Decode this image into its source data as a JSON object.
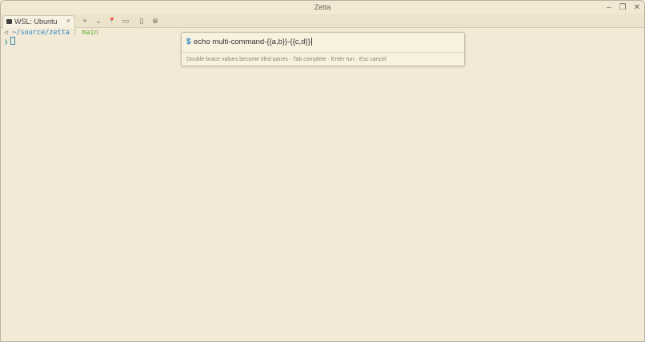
{
  "window": {
    "title": "Zetta",
    "controls": {
      "minimize": "–",
      "maximize": "❐",
      "close": "✕"
    }
  },
  "tabs": [
    {
      "label": "WSL: Ubuntu",
      "icon": "terminal-icon",
      "close": "×",
      "active": true
    }
  ],
  "toolbar": {
    "new_tab": "+",
    "dropdown": "⌄",
    "pin": "📍",
    "archive": "▭",
    "split": "▯",
    "globe": "⊕"
  },
  "terminal": {
    "path_prefix": "◁ ",
    "path": "~/source/zetta",
    "branch_icon": "ᚴ",
    "branch": "main",
    "prompt_symbol": "❯"
  },
  "command_palette": {
    "prompt": "$",
    "input_value": "echo multi-command-{{a,b}}-{{c,d}}",
    "hint": "Double-brace values become tiled panes · Tab complete · Enter run · Esc cancel"
  },
  "colors": {
    "background": "#f2ead5",
    "accent_blue": "#2a85c6",
    "accent_green": "#6aaa3a"
  }
}
